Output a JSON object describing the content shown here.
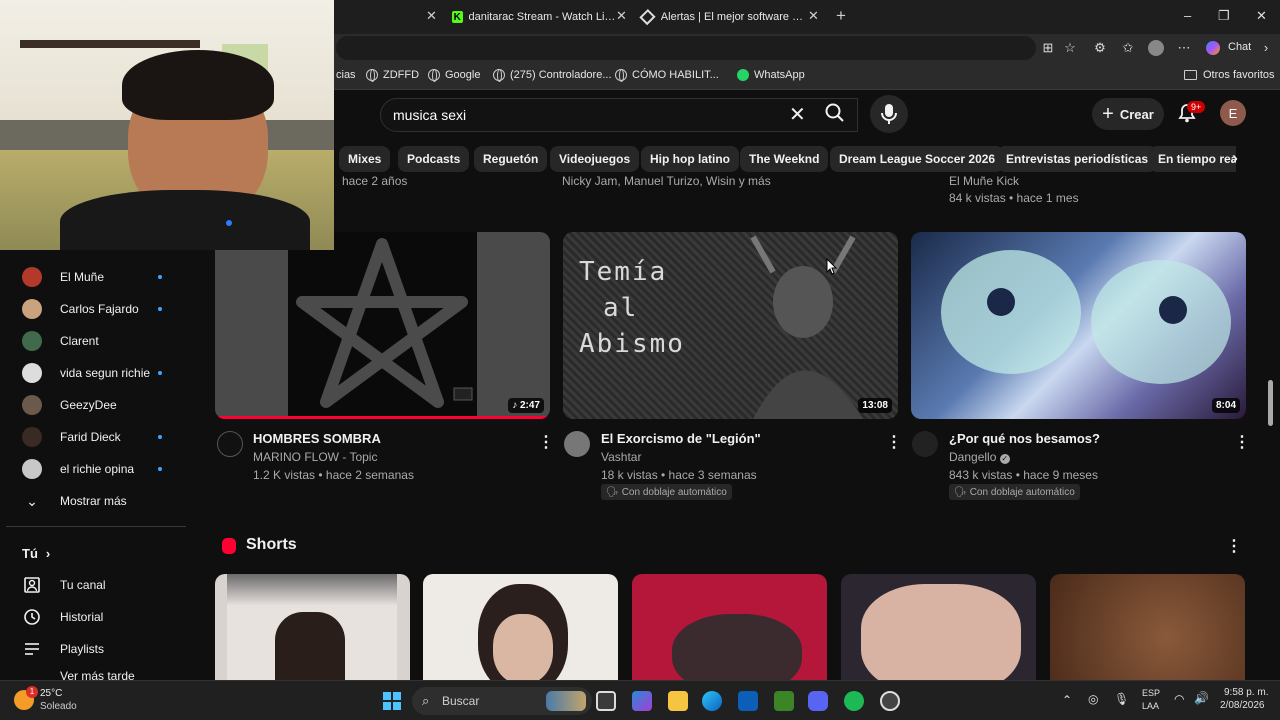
{
  "browser": {
    "tabs": [
      {
        "label": "danitarac Stream - Watch Live on K"
      },
      {
        "label": "Alertas | El mejor software para po"
      }
    ],
    "new_tab": "+",
    "window_controls": {
      "minimize": "–",
      "maximize": "❐",
      "close": "✕"
    },
    "chat_label": "Chat",
    "bookmarks": [
      {
        "label": "cias",
        "icon": "folder-icon"
      },
      {
        "label": "ZDFFD",
        "icon": "globe-icon"
      },
      {
        "label": "Google",
        "icon": "globe-icon"
      },
      {
        "label": "(275) Controladore...",
        "icon": "globe-icon"
      },
      {
        "label": "CÓMO HABILIT...",
        "icon": "globe-icon"
      },
      {
        "label": "WhatsApp",
        "icon": "whatsapp-icon"
      }
    ],
    "other_favorites": "Otros favoritos"
  },
  "youtube": {
    "search": {
      "value": "musica sexi"
    },
    "create_label": "Crear",
    "notif_count": "9+",
    "avatar_letter": "E",
    "chips": [
      "Mixes",
      "Podcasts",
      "Reguetón",
      "Videojuegos",
      "Hip hop latino",
      "The Weeknd",
      "Dream League Soccer 2026",
      "Entrevistas periodísticas",
      "En tiempo real"
    ],
    "previous_row": [
      {
        "text": "hace 2 años"
      },
      {
        "text": "Nicky Jam, Manuel Turizo, Wisin y más"
      },
      {
        "text": "El Muñe Kick"
      },
      {
        "text": "84 k vistas • hace 1 mes"
      }
    ],
    "sidebar": {
      "subscriptions": [
        {
          "name": "El Muñe",
          "dot": true,
          "color": "#b33a2a"
        },
        {
          "name": "Carlos Fajardo",
          "dot": true,
          "color": "#c9a27e"
        },
        {
          "name": "Clarent",
          "dot": false,
          "color": "#3f6b4c"
        },
        {
          "name": "vida segun richie",
          "dot": true,
          "color": "#ddd"
        },
        {
          "name": "GeezyDee",
          "dot": false,
          "color": "#6b5a4a"
        },
        {
          "name": "Farid Dieck",
          "dot": true,
          "color": "#3a2a24"
        },
        {
          "name": "el richie opina",
          "dot": true,
          "color": "#c8c8c8"
        }
      ],
      "show_more": "Mostrar más",
      "you_label": "Tú",
      "you_items": [
        "Tu canal",
        "Historial",
        "Playlists",
        "Ver más tarde"
      ]
    },
    "videos": [
      {
        "title": "HOMBRES SOMBRA",
        "channel": "MARINO FLOW - Topic",
        "meta": "1.2 K vistas • hace 2 semanas",
        "duration": "♪ 2:47",
        "badge": "",
        "progress": 1.0
      },
      {
        "title": "El Exorcismo de \"Legión\"",
        "channel": "Vashtar",
        "meta": "18 k vistas • hace 3 semanas",
        "duration": "13:08",
        "badge": "Con doblaje automático",
        "thumb_text": "Temía al Abismo"
      },
      {
        "title": "¿Por qué nos besamos?",
        "channel": "Dangello",
        "meta": "843 k vistas • hace 9 meses",
        "duration": "8:04",
        "badge": "Con doblaje automático",
        "verified": true
      }
    ],
    "shorts_title": "Shorts"
  },
  "taskbar": {
    "weather_temp": "25°C",
    "weather_desc": "Soleado",
    "search_placeholder": "Buscar",
    "lang": "ESP",
    "lang2": "LAA",
    "time": "9:58 p. m.",
    "date": "2/08/2026",
    "weather_badge": "1"
  }
}
